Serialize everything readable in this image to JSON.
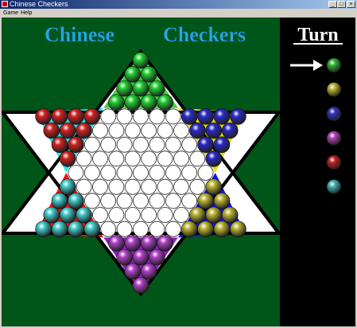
{
  "window": {
    "title": "Chinese Checkers",
    "min_glyph": "_",
    "max_glyph": "□",
    "close_glyph": "×"
  },
  "menu": [
    {
      "label": "Game"
    },
    {
      "label": "Help"
    }
  ],
  "board": {
    "title_left": "Chinese",
    "title_right": "Checkers",
    "background_color": "#005518",
    "hole_color": "#ffffff",
    "center_color": "#ffffff",
    "camps": [
      {
        "name": "top",
        "color": "#20d030",
        "fill": "#40d040"
      },
      {
        "name": "upper-left",
        "color": "#40c8c8",
        "fill": "#20e8f0"
      },
      {
        "name": "upper-right",
        "color": "#b8b030",
        "fill": "#e8e000"
      },
      {
        "name": "lower-left",
        "color": "#d02020",
        "fill": "#f01010"
      },
      {
        "name": "lower-right",
        "color": "#2828c8",
        "fill": "#1010f0"
      },
      {
        "name": "bottom",
        "color": "#b040c8",
        "fill": "#9020c8"
      }
    ]
  },
  "turn": {
    "heading": "Turn",
    "current_index": 0,
    "players": [
      {
        "color": "#30b030",
        "icon": "green-marble"
      },
      {
        "color": "#b8b030",
        "icon": "yellow-marble"
      },
      {
        "color": "#3030c0",
        "icon": "blue-marble"
      },
      {
        "color": "#b040b8",
        "icon": "purple-marble"
      },
      {
        "color": "#c02020",
        "icon": "red-marble"
      },
      {
        "color": "#40b0b0",
        "icon": "cyan-marble"
      }
    ]
  }
}
